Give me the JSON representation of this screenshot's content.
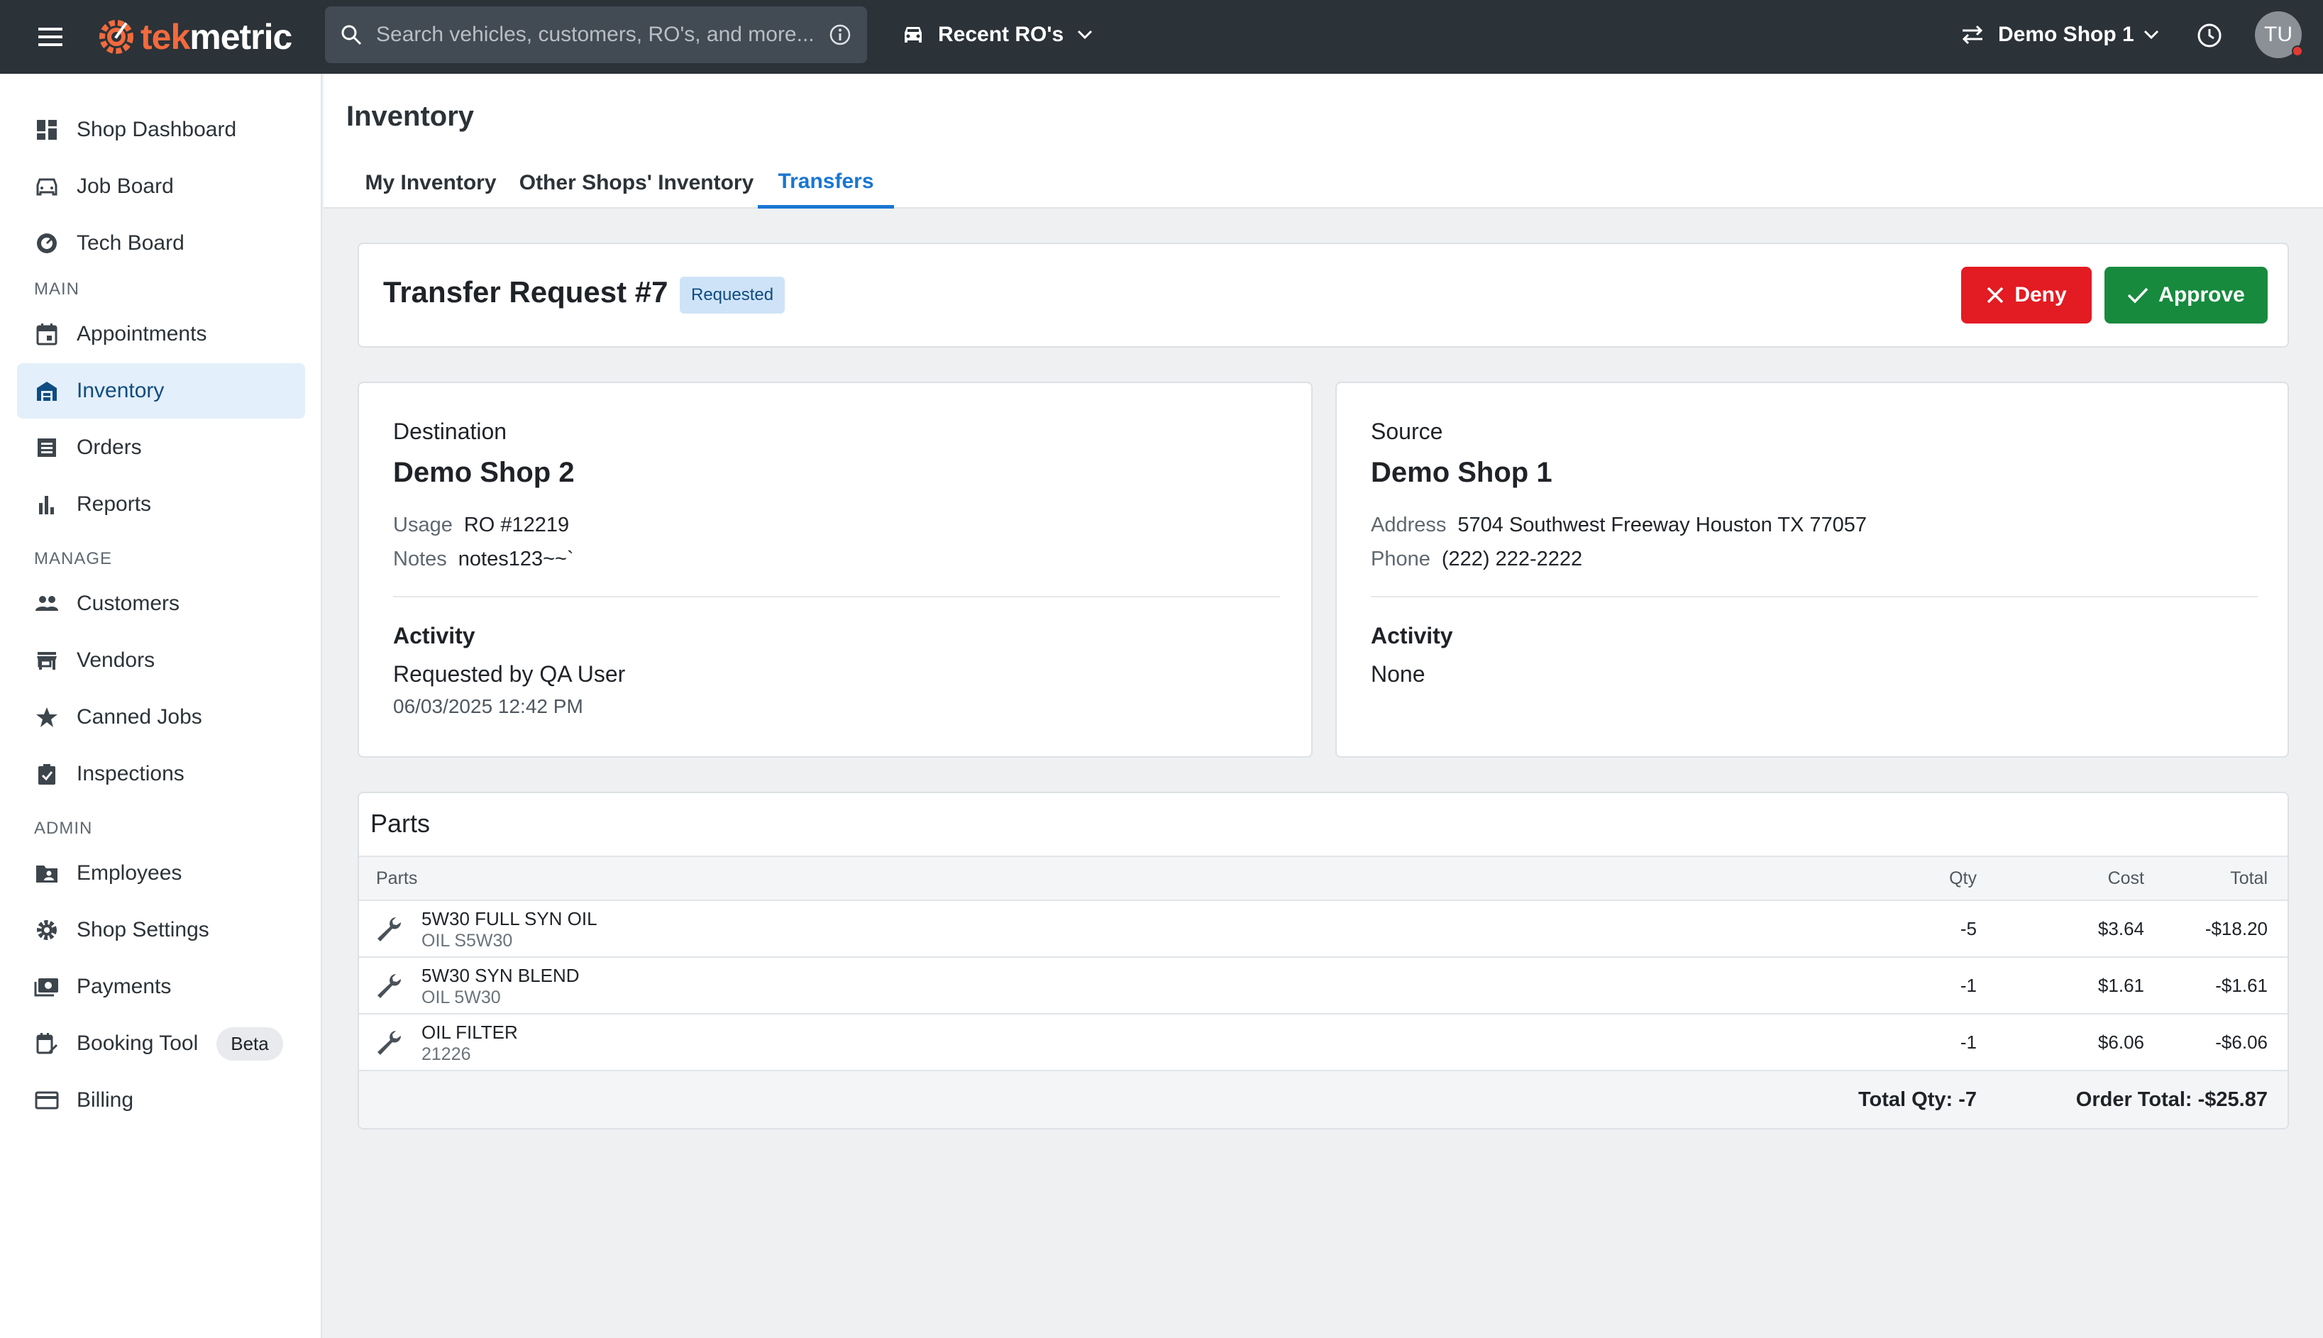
{
  "topbar": {
    "logo_tek": "tek",
    "logo_metric": "metric",
    "search_placeholder": "Search vehicles, customers, RO's, and more...",
    "recent_label": "Recent RO's",
    "shop_label": "Demo Shop 1",
    "avatar_initials": "TU"
  },
  "sidebar": {
    "items": [
      {
        "label": "Shop Dashboard",
        "icon": "dashboard-icon"
      },
      {
        "label": "Job Board",
        "icon": "car-icon"
      },
      {
        "label": "Tech Board",
        "icon": "gauge-icon"
      },
      {
        "label": "Appointments",
        "icon": "calendar-icon"
      },
      {
        "label": "Inventory",
        "icon": "warehouse-icon"
      },
      {
        "label": "Orders",
        "icon": "list-icon"
      },
      {
        "label": "Reports",
        "icon": "bar-chart-icon"
      },
      {
        "label": "Customers",
        "icon": "people-icon"
      },
      {
        "label": "Vendors",
        "icon": "store-icon"
      },
      {
        "label": "Canned Jobs",
        "icon": "star-icon"
      },
      {
        "label": "Inspections",
        "icon": "clipboard-icon"
      },
      {
        "label": "Employees",
        "icon": "folder-person-icon"
      },
      {
        "label": "Shop Settings",
        "icon": "gear-icon"
      },
      {
        "label": "Payments",
        "icon": "money-icon"
      },
      {
        "label": "Booking Tool",
        "icon": "calendar-edit-icon",
        "badge": "Beta"
      },
      {
        "label": "Billing",
        "icon": "credit-card-icon"
      }
    ],
    "sections": {
      "main": "MAIN",
      "manage": "MANAGE",
      "admin": "ADMIN"
    }
  },
  "header": {
    "title": "Inventory",
    "tabs": [
      "My Inventory",
      "Other Shops' Inventory",
      "Transfers"
    ],
    "active_tab": "Transfers"
  },
  "request": {
    "title": "Transfer Request #7",
    "status": "Requested",
    "deny_label": "Deny",
    "approve_label": "Approve"
  },
  "destination": {
    "heading": "Destination",
    "name": "Demo Shop 2",
    "usage_label": "Usage",
    "usage_value": "RO #12219",
    "notes_label": "Notes",
    "notes_value": "notes123~~`",
    "activity_heading": "Activity",
    "activity_text": "Requested by QA User",
    "activity_date": "06/03/2025  12:42 PM"
  },
  "source": {
    "heading": "Source",
    "name": "Demo Shop 1",
    "address_label": "Address",
    "address_value": "5704 Southwest Freeway Houston TX 77057",
    "phone_label": "Phone",
    "phone_value": "(222) 222-2222",
    "activity_heading": "Activity",
    "activity_text": "None"
  },
  "parts": {
    "title": "Parts",
    "columns": {
      "parts": "Parts",
      "qty": "Qty",
      "cost": "Cost",
      "total": "Total"
    },
    "rows": [
      {
        "name": "5W30 FULL SYN OIL",
        "code": "OIL S5W30",
        "qty": "-5",
        "cost": "$3.64",
        "total": "-$18.20"
      },
      {
        "name": "5W30 SYN BLEND",
        "code": "OIL 5W30",
        "qty": "-1",
        "cost": "$1.61",
        "total": "-$1.61"
      },
      {
        "name": "OIL FILTER",
        "code": "21226",
        "qty": "-1",
        "cost": "$6.06",
        "total": "-$6.06"
      }
    ],
    "total_qty": "Total Qty: -7",
    "order_total": "Order Total: -$25.87"
  },
  "colors": {
    "accent": "#1976d2",
    "deny": "#e31b23",
    "approve": "#178a3e",
    "topbar": "#2b3238",
    "logo": "#f26a3d"
  }
}
